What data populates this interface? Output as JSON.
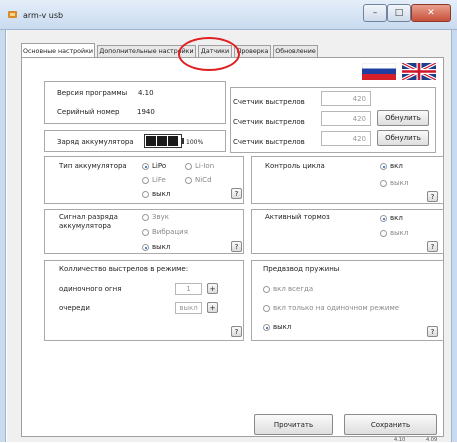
{
  "window": {
    "title": "arm-v usb",
    "minimize": "–",
    "maximize": "□",
    "close": "✕"
  },
  "tabs": [
    {
      "label": "Основные настройки"
    },
    {
      "label": "Дополнительные настройки"
    },
    {
      "label": "Датчики"
    },
    {
      "label": "Проверка"
    },
    {
      "label": "Обновление"
    }
  ],
  "info": {
    "version_label": "Версия программы",
    "version": "4.10",
    "serial_label": "Серийный номер",
    "serial": "1940",
    "battery_label": "Заряд аккумулятора",
    "battery_percent": "100%",
    "battery_level": 1.0
  },
  "counters": [
    {
      "label": "Счетчик выстрелов",
      "value": "420"
    },
    {
      "label": "Счетчик выстрелов",
      "value": "420",
      "reset": "Обнулить"
    },
    {
      "label": "Счетчик выстрелов",
      "value": "420",
      "reset": "Обнулить"
    }
  ],
  "battery_type": {
    "label": "Тип аккумулятора",
    "options": [
      "LiPo",
      "Li-Ion",
      "LiFe",
      "NiCd",
      "выкл"
    ],
    "selected": "LiPo"
  },
  "cycle_control": {
    "label": "Контроль цикла",
    "options": [
      "вкл",
      "выкл"
    ],
    "selected": "вкл"
  },
  "discharge_signal": {
    "label": "Сигнал разряда аккумулятора",
    "options": [
      "Звук",
      "Вибрация",
      "выкл"
    ],
    "selected": "выкл"
  },
  "active_brake": {
    "label": "Активный тормоз",
    "options": [
      "вкл",
      "выкл"
    ],
    "selected": "вкл"
  },
  "shots": {
    "label": "Колличество выстрелов в режиме:",
    "single_label": "одиночного огня",
    "single_value": "1",
    "burst_label": "очереди",
    "burst_value": "выкл",
    "plus": "+"
  },
  "prespring": {
    "label": "Предвзвод пружины",
    "options": [
      "вкл всегда",
      "вкл только на одиночном режиме",
      "выкл"
    ],
    "selected": "выкл"
  },
  "help": "?",
  "actions": {
    "read": "Прочитать",
    "save": "Сохранить"
  },
  "footer": {
    "left": "4.10",
    "right": "4.09"
  },
  "colors": {
    "selected_radio": "#1e62b8",
    "annotation": "#e02020"
  }
}
